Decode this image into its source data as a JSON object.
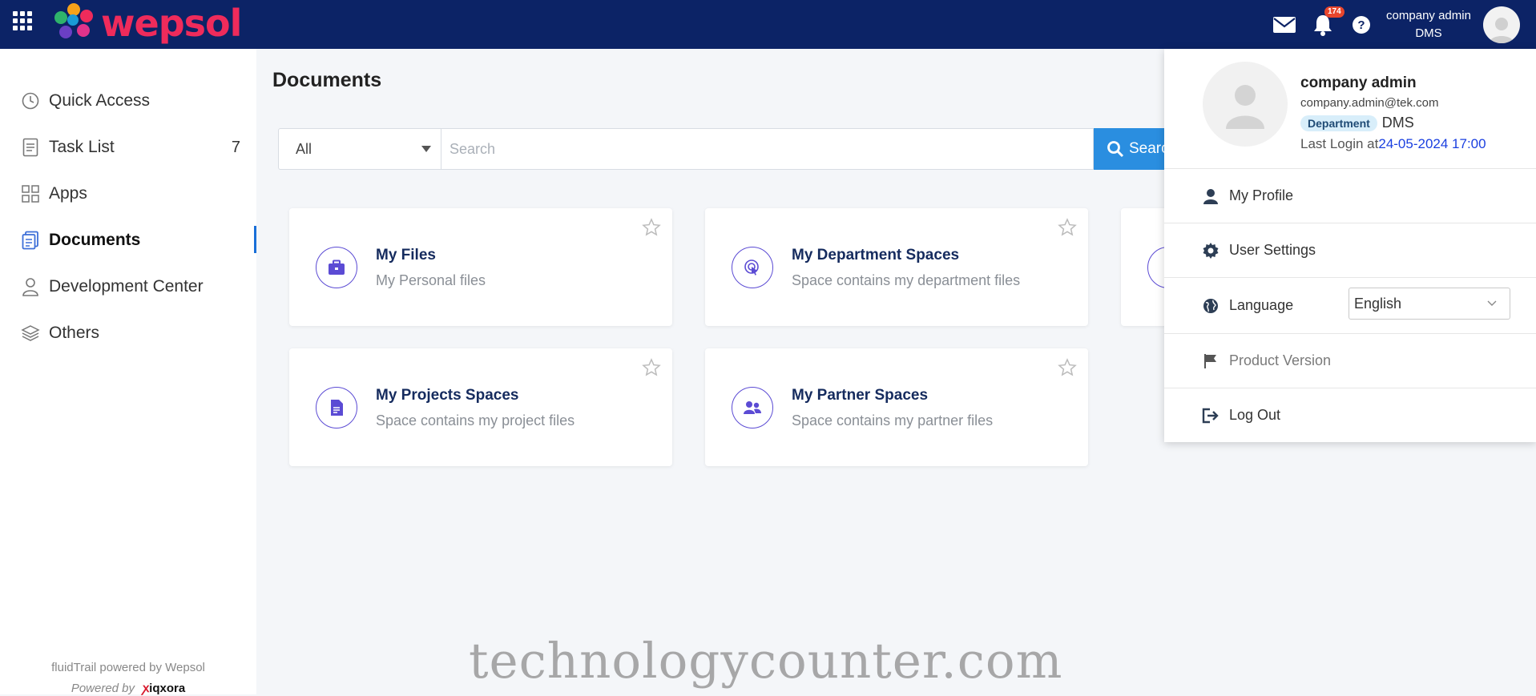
{
  "app": {
    "brand_name": "wepsol",
    "brand_color": "#ef2b5b",
    "topbar_color": "#0c2366",
    "accent_color": "#2a8ee0"
  },
  "header": {
    "notification_count": "174",
    "user_name": "company admin",
    "user_department": "DMS",
    "icons": [
      "apps-grid-icon",
      "mail-icon",
      "bell-icon",
      "help-icon",
      "avatar-icon"
    ]
  },
  "sidebar": {
    "items": [
      {
        "label": "Quick Access",
        "icon": "clock-icon"
      },
      {
        "label": "Task List",
        "icon": "checklist-icon",
        "count": "7"
      },
      {
        "label": "Apps",
        "icon": "grid-icon"
      },
      {
        "label": "Documents",
        "icon": "documents-icon",
        "active": true
      },
      {
        "label": "Development Center",
        "icon": "user-icon"
      },
      {
        "label": "Others",
        "icon": "layers-icon"
      }
    ],
    "footer_line1": "fluidTrail powered by Wepsol",
    "footer_line2_prefix": "Powered by",
    "footer_line2_brand": "iqxora"
  },
  "main": {
    "title": "Documents",
    "filter_value": "All",
    "search_placeholder": "Search",
    "search_button_label": "Search",
    "cards": [
      {
        "title": "My Files",
        "subtitle": "My Personal files",
        "icon": "briefcase-icon"
      },
      {
        "title": "My Department Spaces",
        "subtitle": "Space contains my department files",
        "icon": "department-icon"
      },
      {
        "title": "My Projects Spaces",
        "subtitle": "Space contains my project files",
        "icon": "document-icon"
      },
      {
        "title": "My Partner Spaces",
        "subtitle": "Space contains my partner files",
        "icon": "partners-icon"
      }
    ]
  },
  "profile_menu": {
    "name": "company admin",
    "email": "company.admin@tek.com",
    "department_tag": "Department",
    "department_value": "DMS",
    "last_login_label": "Last Login at",
    "last_login_value": "24-05-2024 17:00",
    "items": {
      "my_profile": "My Profile",
      "user_settings": "User Settings",
      "language": "Language",
      "language_value": "English",
      "product_version": "Product Version",
      "log_out": "Log Out"
    }
  },
  "watermark": "technologycounter.com"
}
